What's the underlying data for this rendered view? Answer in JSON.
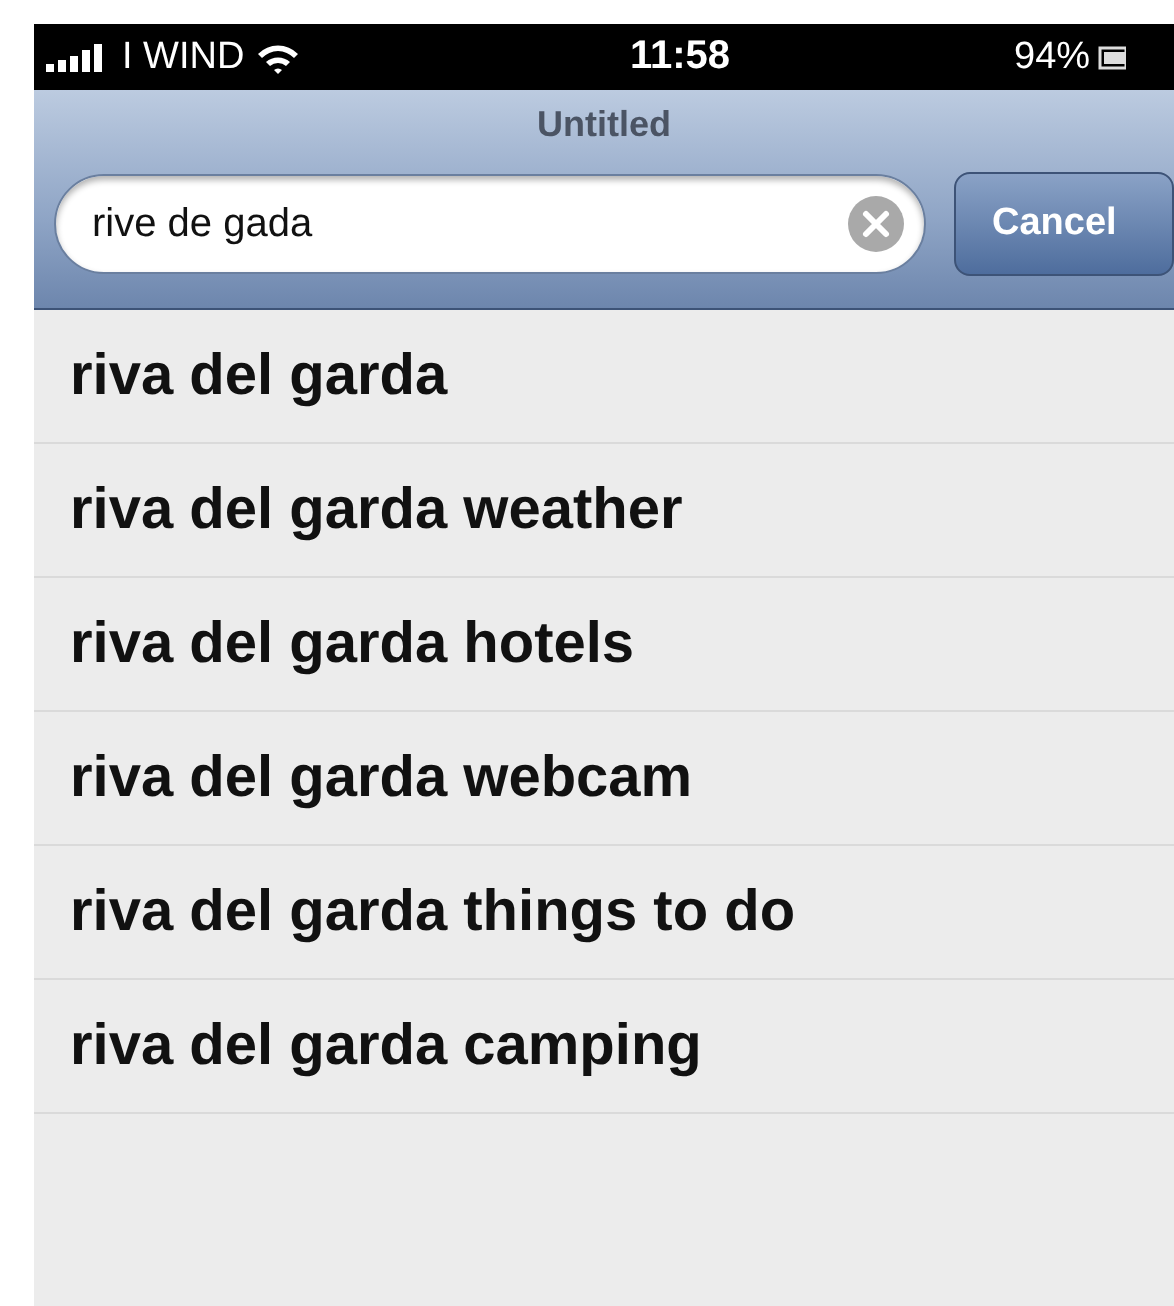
{
  "status_bar": {
    "carrier": "I WIND",
    "time": "11:58",
    "battery": "94%"
  },
  "nav_bar": {
    "title": "Untitled"
  },
  "search": {
    "value": "rive de gada",
    "cancel": "Cancel"
  },
  "suggestions": [
    "riva del garda",
    "riva del garda weather",
    "riva del garda hotels",
    "riva del garda webcam",
    "riva del garda things to do",
    "riva del garda camping"
  ]
}
